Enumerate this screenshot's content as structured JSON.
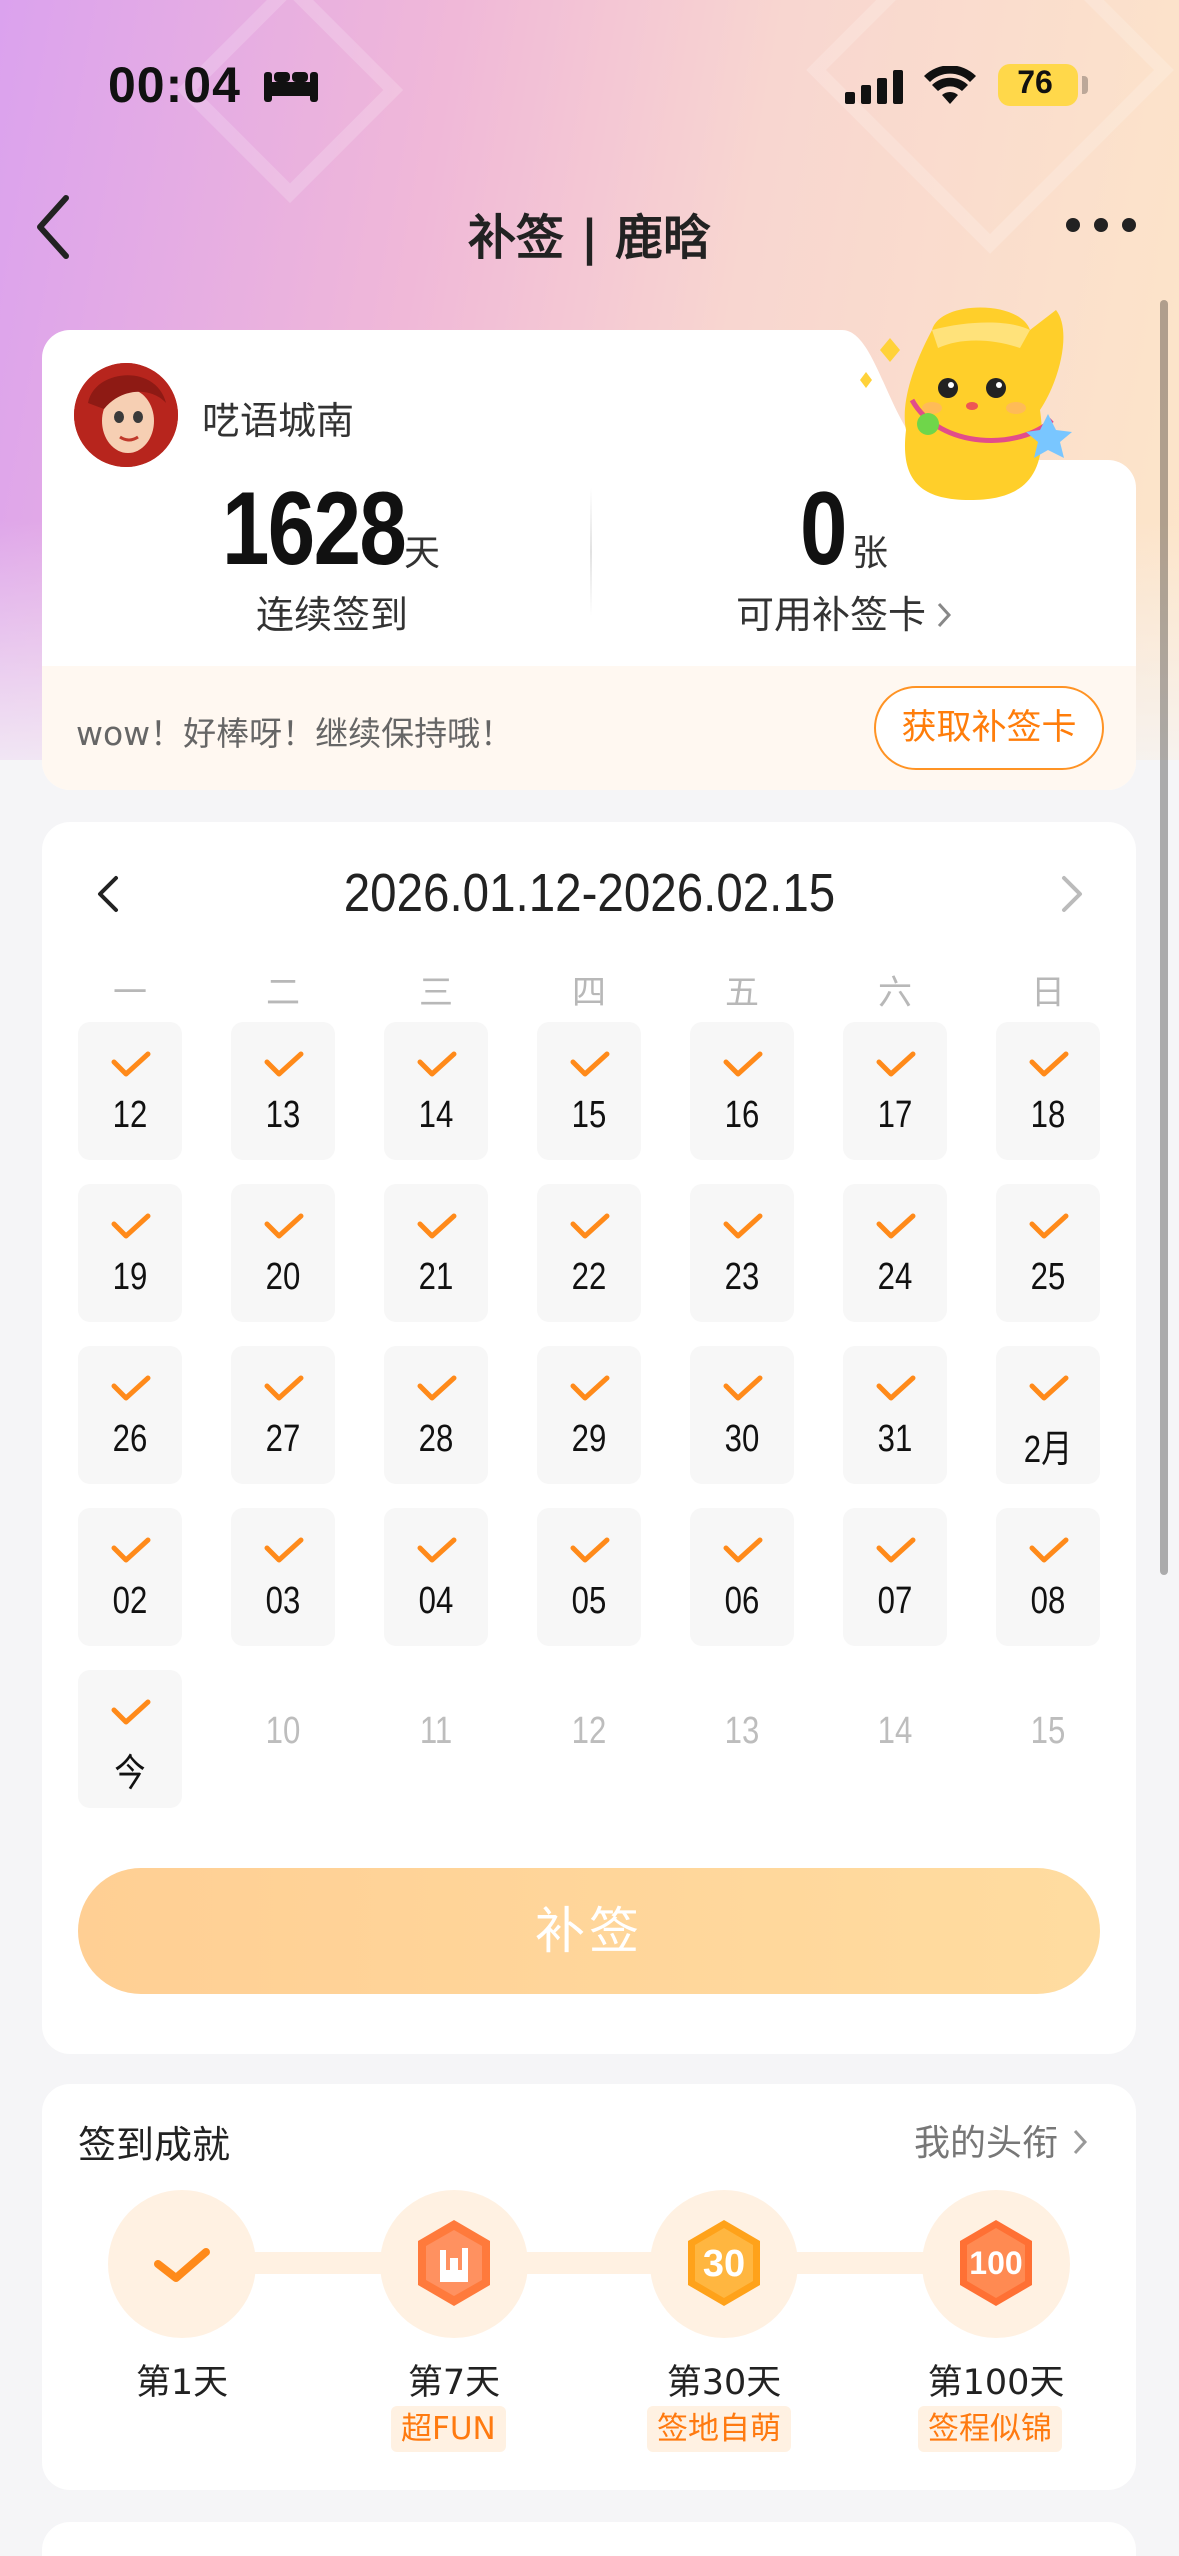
{
  "status_bar": {
    "time": "00:04",
    "battery": "76"
  },
  "header": {
    "title": "补签 | 鹿晗"
  },
  "profile": {
    "username": "呓语城南",
    "streak_days": "1628",
    "streak_unit": "天",
    "streak_label": "连续签到",
    "cards_count": "0",
    "cards_unit": "张",
    "cards_label": "可用补签卡",
    "message": "wow！好棒呀！继续保持哦！",
    "get_card_button": "获取补签卡"
  },
  "calendar": {
    "range": "2026.01.12-2026.02.15",
    "weekdays": [
      "一",
      "二",
      "三",
      "四",
      "五",
      "六",
      "日"
    ],
    "checked_days": [
      "12",
      "13",
      "14",
      "15",
      "16",
      "17",
      "18",
      "19",
      "20",
      "21",
      "22",
      "23",
      "24",
      "25",
      "26",
      "27",
      "28",
      "29",
      "30",
      "31",
      "2月",
      "02",
      "03",
      "04",
      "05",
      "06",
      "07",
      "08",
      "今"
    ],
    "future_days": [
      "10",
      "11",
      "12",
      "13",
      "14",
      "15"
    ],
    "resign_button": "补签"
  },
  "achievements": {
    "title": "签到成就",
    "link": "我的头衔",
    "items": [
      {
        "label": "第1天",
        "tag": ""
      },
      {
        "label": "第7天",
        "tag": "超FUN"
      },
      {
        "label": "第30天",
        "tag": "签地自萌"
      },
      {
        "label": "第100天",
        "tag": "签程似锦"
      }
    ]
  },
  "colors": {
    "accent": "#ff8a1a",
    "button_gradient_start": "#ffcf94",
    "button_gradient_end": "#ffdca0"
  }
}
